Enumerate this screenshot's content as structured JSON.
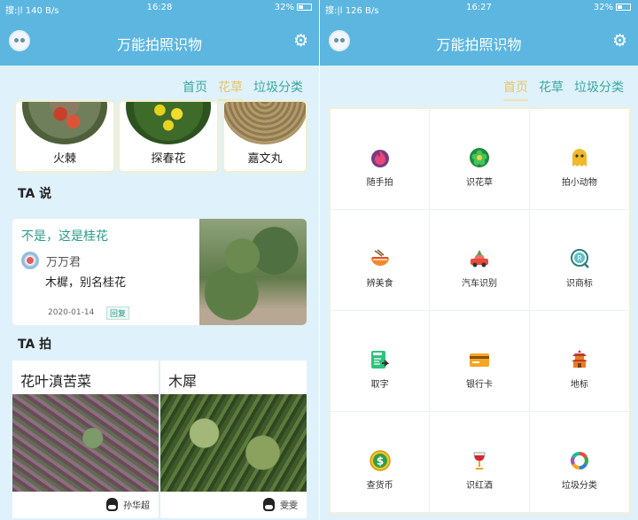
{
  "left_screen": {
    "status": {
      "carrier": "搜:|l",
      "speed": "140 B/s",
      "time": "16:28",
      "battery": "32%"
    },
    "appbar": {
      "title": "万能拍照识物"
    },
    "tabs": [
      {
        "label": "首页"
      },
      {
        "label": "花草"
      },
      {
        "label": "垃圾分类"
      }
    ],
    "flowers": [
      {
        "name": "火棘"
      },
      {
        "name": "探春花"
      },
      {
        "name": "嘉文丸"
      }
    ],
    "ta_say": {
      "title": "TA 说",
      "headline": "不是，这是桂花",
      "user": "万万君",
      "body": "木樨，别名桂花",
      "date": "2020-01-14",
      "reply": "回复"
    },
    "ta_shoot": {
      "title": "TA 拍",
      "items": [
        {
          "caption": "花叶滇苦菜",
          "author": "孙华超"
        },
        {
          "caption": "木犀",
          "author": "雯雯"
        }
      ]
    }
  },
  "right_screen": {
    "status": {
      "carrier": "搜:|l",
      "speed": "126 B/s",
      "time": "16:27",
      "battery": "32%"
    },
    "appbar": {
      "title": "万能拍照识物"
    },
    "tabs": [
      {
        "label": "首页"
      },
      {
        "label": "花草"
      },
      {
        "label": "垃圾分类"
      }
    ],
    "features": [
      {
        "label": "随手拍",
        "icon": "flame-icon"
      },
      {
        "label": "识花草",
        "icon": "flower-icon"
      },
      {
        "label": "拍小动物",
        "icon": "ghost-icon"
      },
      {
        "label": "辨美食",
        "icon": "noodle-bowl-icon"
      },
      {
        "label": "汽车识别",
        "icon": "car-icon"
      },
      {
        "label": "识商标",
        "icon": "trademark-icon"
      },
      {
        "label": "取字",
        "icon": "ocr-icon"
      },
      {
        "label": "银行卡",
        "icon": "bank-card-icon"
      },
      {
        "label": "地标",
        "icon": "pagoda-icon"
      },
      {
        "label": "查货币",
        "icon": "coin-icon"
      },
      {
        "label": "识红酒",
        "icon": "wine-glass-icon"
      },
      {
        "label": "垃圾分类",
        "icon": "recycle-icon"
      }
    ]
  },
  "colors": {
    "primary": "#5cb6e0",
    "background": "#dff1fb",
    "tab_active": "#e8c465",
    "tab": "#3aa8a0",
    "accent_text": "#2a9a8a"
  }
}
